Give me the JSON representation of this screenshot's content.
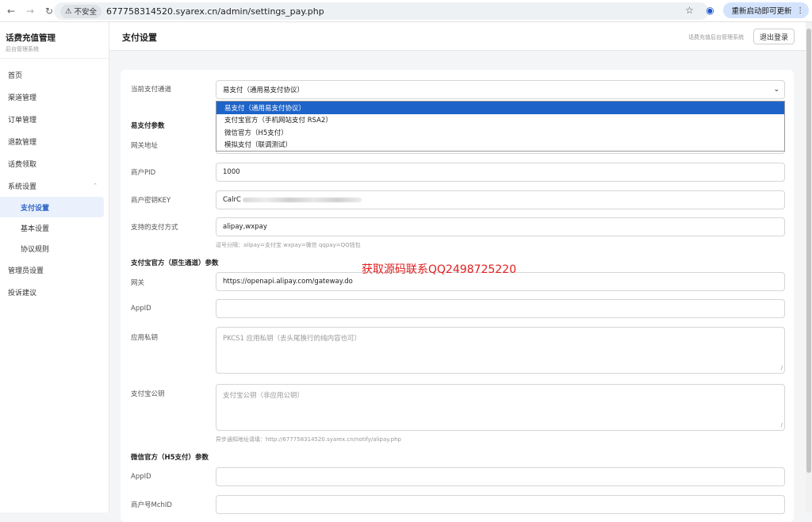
{
  "browser": {
    "insecure_label": "不安全",
    "url": "677758314520.syarex.cn/admin/settings_pay.php",
    "update_label": "重新启动即可更新"
  },
  "sidebar": {
    "title": "话费充值管理",
    "subtitle": "后台管理系统",
    "items": [
      {
        "label": "首页"
      },
      {
        "label": "渠道管理"
      },
      {
        "label": "订单管理"
      },
      {
        "label": "退款管理"
      },
      {
        "label": "话费领取"
      },
      {
        "label": "系统设置"
      }
    ],
    "sub_items": [
      {
        "label": "支付设置"
      },
      {
        "label": "基本设置"
      },
      {
        "label": "协议规则"
      }
    ],
    "items_after": [
      {
        "label": "管理员设置"
      },
      {
        "label": "投诉建议"
      }
    ]
  },
  "header": {
    "title": "支付设置",
    "system_name": "话费充值后台管理系统",
    "logout_label": "退出登录"
  },
  "form": {
    "channel_label": "当前支付通道",
    "channel_value": "易支付（通用易支付协议）",
    "channel_options": [
      "易支付（通用易支付协议）",
      "支付宝官方（手机网站支付 RSA2）",
      "微信官方（H5支付）",
      "模拟支付（联调测试）"
    ],
    "epay_section": "易支付参数",
    "gateway_label": "网关地址",
    "pid_label": "商户PID",
    "pid_value": "1000",
    "key_label": "商户密钥KEY",
    "key_value": "CalrC",
    "methods_label": "支持的支付方式",
    "methods_value": "alipay,wxpay",
    "methods_hint": "逗号分隔：alipay=支付宝 wxpay=微信 qqpay=QQ钱包",
    "alipay_section": "支付宝官方（原生通道）参数",
    "ali_gateway_label": "网关",
    "ali_gateway_value": "https://openapi.alipay.com/gateway.do",
    "ali_appid_label": "AppID",
    "ali_privkey_label": "应用私钥",
    "ali_privkey_placeholder": "PKCS1 应用私钥（去头尾换行的纯内容也可）",
    "ali_pubkey_label": "支付宝公钥",
    "ali_pubkey_placeholder": "支付宝公钥（非应用公钥）",
    "ali_notify_hint": "异步通知地址请填：http://677758314520.syarex.cn/notify/alipay.php",
    "wx_section": "微信官方（H5支付）参数",
    "wx_appid_label": "AppID",
    "wx_mchid_label": "商户号MchID"
  },
  "watermark": "获取源码联系QQ2498725220"
}
